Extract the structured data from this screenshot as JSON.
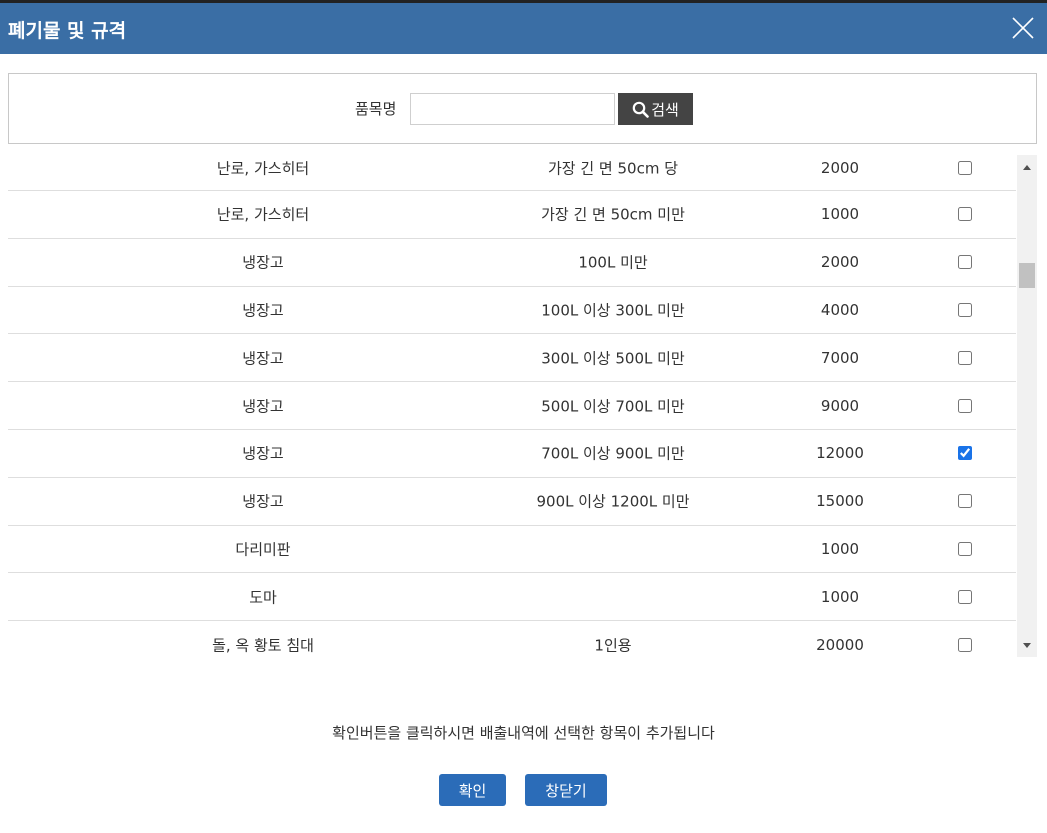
{
  "dialog": {
    "title": "폐기물 및 규격"
  },
  "search": {
    "label": "품목명",
    "value": "",
    "placeholder": "",
    "button_label": "검색"
  },
  "items": [
    {
      "name": "난로, 가스히터",
      "spec": "가장 긴 면 50cm 당",
      "price": "2000",
      "checked": false
    },
    {
      "name": "난로, 가스히터",
      "spec": "가장 긴 면 50cm 미만",
      "price": "1000",
      "checked": false
    },
    {
      "name": "냉장고",
      "spec": "100L 미만",
      "price": "2000",
      "checked": false
    },
    {
      "name": "냉장고",
      "spec": "100L 이상 300L 미만",
      "price": "4000",
      "checked": false
    },
    {
      "name": "냉장고",
      "spec": "300L 이상 500L 미만",
      "price": "7000",
      "checked": false
    },
    {
      "name": "냉장고",
      "spec": "500L 이상 700L 미만",
      "price": "9000",
      "checked": false
    },
    {
      "name": "냉장고",
      "spec": "700L 이상 900L 미만",
      "price": "12000",
      "checked": true
    },
    {
      "name": "냉장고",
      "spec": "900L 이상 1200L 미만",
      "price": "15000",
      "checked": false
    },
    {
      "name": "다리미판",
      "spec": "",
      "price": "1000",
      "checked": false
    },
    {
      "name": "도마",
      "spec": "",
      "price": "1000",
      "checked": false
    },
    {
      "name": "돌, 옥 황토 침대",
      "spec": "1인용",
      "price": "20000",
      "checked": false
    }
  ],
  "notice": "확인버튼을 클릭하시면 배출내역에 선택한 항목이 추가됩니다",
  "buttons": {
    "confirm": "확인",
    "close": "창닫기"
  },
  "colors": {
    "titlebar": "#3a6ea5",
    "button": "#2b6cb8",
    "search_button": "#444444"
  }
}
